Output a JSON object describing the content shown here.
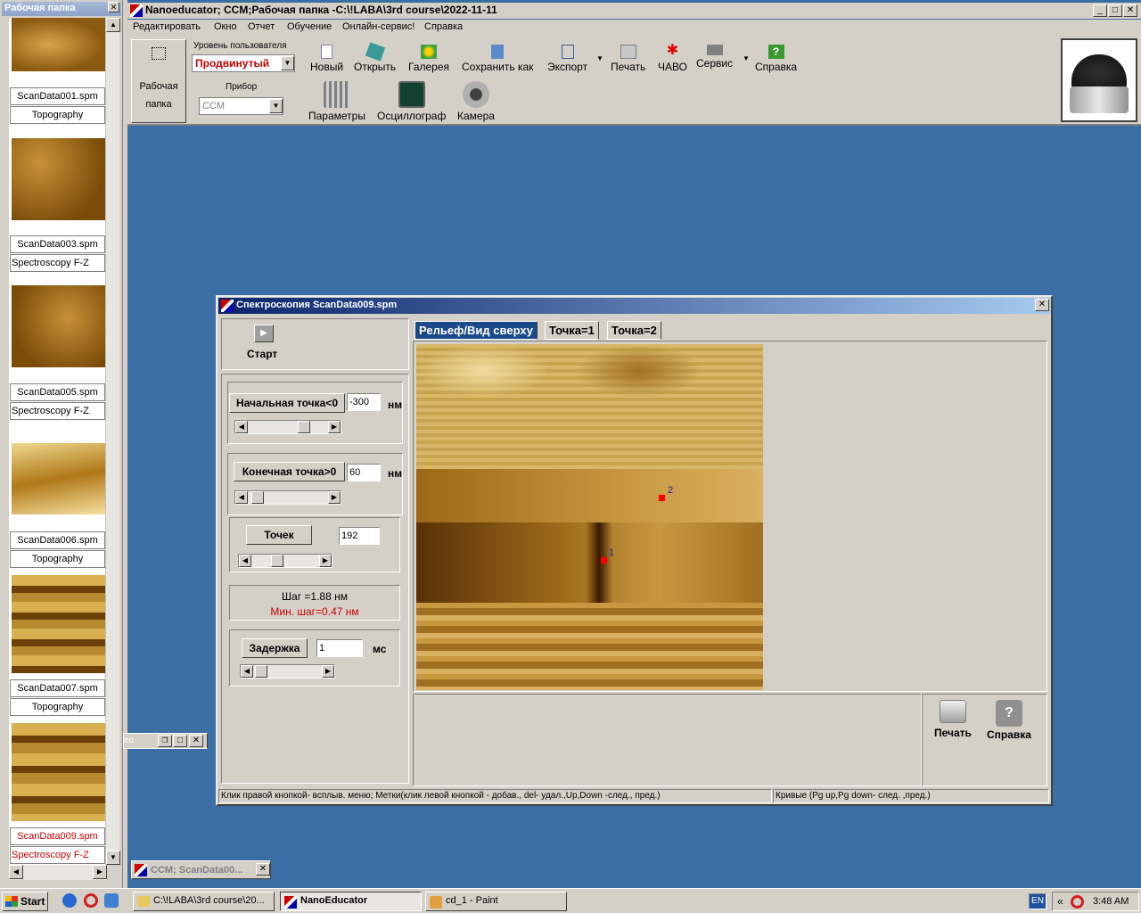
{
  "left_panel": {
    "title": "Рабочая папка",
    "items": [
      {
        "name": "ScanData001.spm",
        "type": "Topography",
        "selected": false
      },
      {
        "name": "ScanData003.spm",
        "type": "Spectroscopy F-Z",
        "selected": false
      },
      {
        "name": "ScanData005.spm",
        "type": "Spectroscopy F-Z",
        "selected": false
      },
      {
        "name": "ScanData006.spm",
        "type": "Topography",
        "selected": false
      },
      {
        "name": "ScanData007.spm",
        "type": "Topography",
        "selected": false
      },
      {
        "name": "ScanData009.spm",
        "type": "Spectroscopy F-Z",
        "selected": true
      }
    ]
  },
  "window": {
    "title": "Nanoeducator; CCM;Рабочая папка -C:\\!LABA\\3rd course\\2022-11-11"
  },
  "menu": [
    "Редактировать",
    "Окно",
    "Отчет",
    "Обучение",
    "Онлайн-сервис!",
    "Справка"
  ],
  "workfolder": {
    "line1": "Рабочая",
    "line2": "папка"
  },
  "user_level": {
    "label": "Уровень пользователя",
    "value": "Продвинутый"
  },
  "device": {
    "label": "Прибор",
    "value": "CCM"
  },
  "toolbar": {
    "new": "Новый",
    "open": "Открыть",
    "gallery": "Галерея",
    "save_as": "Сохранить как",
    "export": "Экспорт",
    "print": "Печать",
    "faq": "ЧАВО",
    "service": "Сервис",
    "help": "Справка",
    "params": "Параметры",
    "oscilloscope": "Осциллограф",
    "camera": "Камера"
  },
  "spec": {
    "title": "Спектроскопия ScanData009.spm",
    "start": "Старт",
    "start_point_label": "Начальная точка<0",
    "start_point_value": "-300",
    "end_point_label": "Конечная точка>0",
    "end_point_value": "60",
    "unit_nm": "нм",
    "points_label": "Точек",
    "points_value": "192",
    "step": "Шаг =1.88 нм",
    "min_step": "Мин. шаг=0.47 нм",
    "delay_label": "Задержка",
    "delay_value": "1",
    "unit_ms": "мс",
    "tabs": [
      "Рельеф/Вид сверху",
      "Точка=1",
      "Точка=2"
    ],
    "marker1": "1",
    "marker2": "2",
    "print": "Печать",
    "help": "Справка",
    "status_left": "Клик правой кнопкой-  всплыв. меню; Метки(клик левой кнопкой - добав., del- удал.,Up,Down -след., пред.)",
    "status_right": "Кривые (Pg up,Pg down- след. ,пред.)"
  },
  "minimized": {
    "text": "CCM;  ScanData00..."
  },
  "floating": {
    "text": "eo"
  },
  "taskbar": {
    "start": "Start",
    "tasks": [
      "C:\\!LABA\\3rd course\\20...",
      "NanoEducator",
      "cd_1 - Paint"
    ],
    "lang": "EN",
    "time": "3:48 AM"
  },
  "colors": {
    "accent_red": "#cc0000",
    "desktop": "#3a6ea5"
  }
}
